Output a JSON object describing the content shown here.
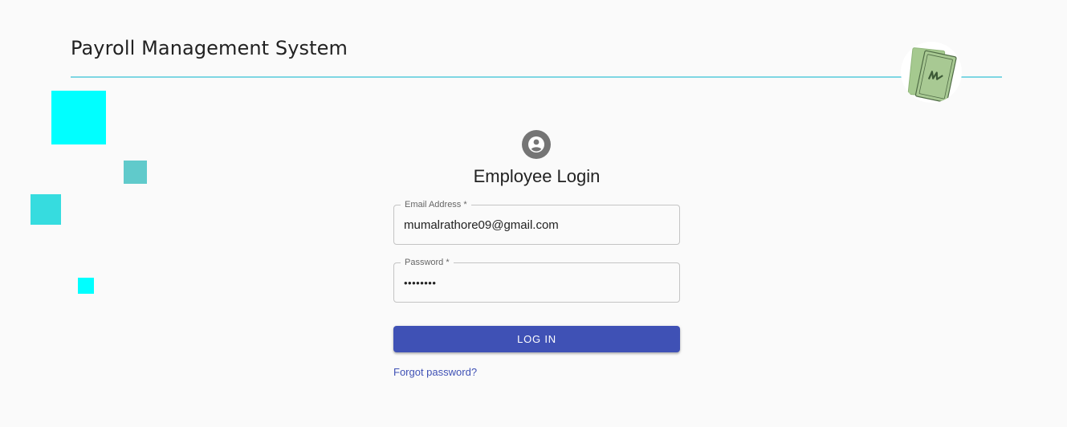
{
  "header": {
    "title": "Payroll Management System",
    "logo_icon": "money-bills-icon"
  },
  "login": {
    "avatar_icon": "account-circle-icon",
    "title": "Employee Login",
    "email": {
      "label": "Email Address *",
      "value": "mumalrathore09@gmail.com"
    },
    "password": {
      "label": "Password *",
      "value": "••••••••"
    },
    "submit_label": "LOG IN",
    "forgot_label": "Forgot password?"
  },
  "colors": {
    "accent": "#3f51b5",
    "header_rule": "#7fd6e3",
    "decor_cyan": "#00ffff",
    "decor_teal": "#60cacb",
    "decor_turquoise": "#36dcdf"
  }
}
